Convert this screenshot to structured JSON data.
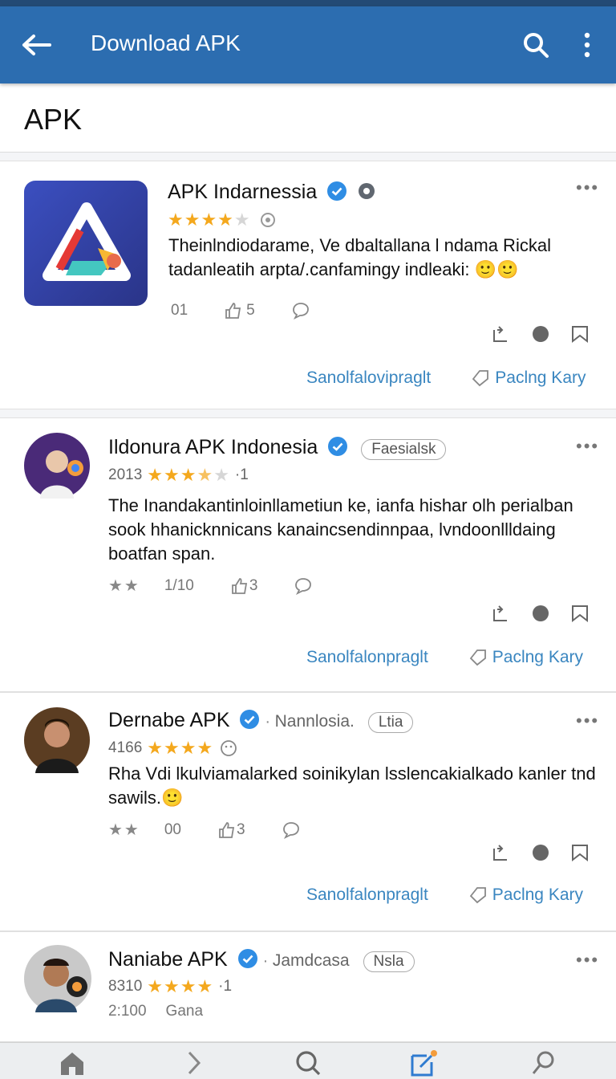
{
  "appbar": {
    "title": "Download APK"
  },
  "section": {
    "label": "APK"
  },
  "posts": [
    {
      "name": "APK Indarnessia",
      "meta_prefix": "",
      "tag": "",
      "body": "Theinlndiodarame, Ve dbaltallana l ndama Rickal tadanleatih arpta/.canfamingy indleaki: 🙂🙂",
      "stat_a": "01",
      "stat_b": "5",
      "link_left": "Sanolfalovipraglt",
      "link_right": "Paclng Kary",
      "stars": 4
    },
    {
      "name": "Ildonura APK Indonesia",
      "meta_prefix": "2013",
      "meta_suffix": "·1",
      "tag": "Faesialsk",
      "body": "The Inandakantinloinllametiun ke, ianfa hishar olh perialban sook hhanicknnicans kanaincsendinnpaa, lvndoonllldaing boatfan span.",
      "stat_stars": "★★",
      "stat_a": "1/10",
      "stat_b": "3",
      "link_left": "Sanolfalonpraglt",
      "link_right": "Paclng Kary",
      "stars": 3.5
    },
    {
      "name": "Dernabe APK",
      "meta_prefix": "4166",
      "meta_suffix": "",
      "tag_prefix": "Nannlosia.",
      "tag": "Ltia",
      "body": "Rha Vdi lkulviamalarked soinikylan lsslencakialkado kanler tnd sawils.🙂",
      "stat_stars": "★★",
      "stat_a": "00",
      "stat_b": "3",
      "link_left": "Sanolfalonpraglt",
      "link_right": "Paclng Kary",
      "stars": 4
    },
    {
      "name": "Naniabe APK",
      "meta_prefix": "8310",
      "meta_suffix": "·1",
      "tag_prefix": "Jamdcasa",
      "tag": "Nsla",
      "stat_a": "2:100",
      "stat_b": "Gana",
      "stars": 4
    }
  ],
  "colors": {
    "appbar": "#2c6db0",
    "accent": "#3a86c0",
    "star": "#f4a81d"
  },
  "icons": [
    "back-arrow-icon",
    "search-icon",
    "more-vert-icon",
    "verified-icon",
    "share-icon",
    "dot-icon",
    "bookmark-icon",
    "home-icon",
    "chevron-icon",
    "search-nav-icon",
    "edit-icon",
    "magnify-icon"
  ]
}
